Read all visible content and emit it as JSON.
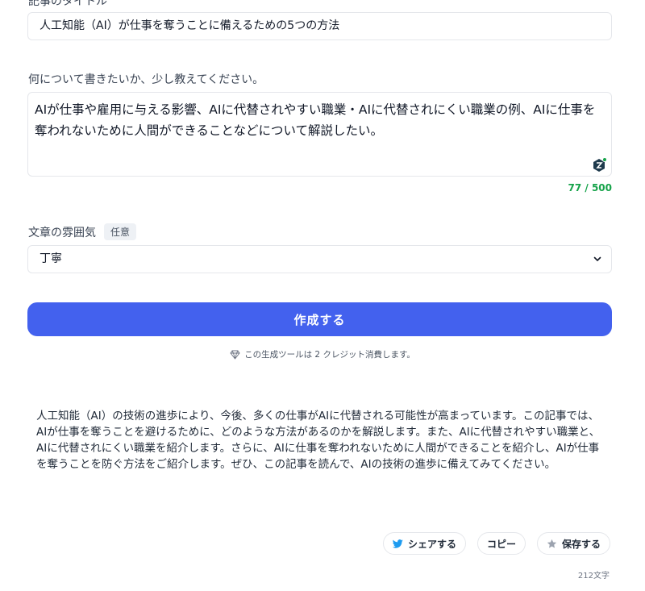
{
  "form": {
    "title_label_cut": "記事のタイトル",
    "title_value": "人工知能（AI）が仕事を奪うことに備えるための5つの方法",
    "description_label": "何について書きたいか、少し教えてください。",
    "description_value": "AIが仕事や雇用に与える影響、AIに代替されやすい職業・AIに代替されにくい職業の例、AIに仕事を奪われないために人間ができることなどについて解説したい。",
    "char_counter": "77 / 500",
    "tone_label": "文章の雰囲気",
    "tone_badge": "任意",
    "tone_selected": "丁寧",
    "submit_label": "作成する",
    "credit_notice": "この生成ツールは 2 クレジット消費します。"
  },
  "result": {
    "text": "人工知能（AI）の技術の進歩により、今後、多くの仕事がAIに代替される可能性が高まっています。この記事では、AIが仕事を奪うことを避けるために、どのような方法があるのかを解説します。また、AIに代替されやすい職業と、AIに代替されにくい職業を紹介します。さらに、AIに仕事を奪われないために人間ができることを紹介し、AIが仕事を奪うことを防ぐ方法をご紹介します。ぜひ、この記事を読んで、AIの技術の進歩に備えてみてください。",
    "share_label": "シェアする",
    "copy_label": "コピー",
    "save_label": "保存する",
    "char_count": "212文字"
  },
  "colors": {
    "primary": "#4361ee",
    "success": "#16a34a",
    "twitter": "#1d9bf0",
    "star": "#9ca3af"
  },
  "icons": {
    "assist": "ai-assist-icon",
    "chevron": "chevron-down-icon",
    "credit": "diamond-icon",
    "share": "twitter-icon",
    "save": "star-icon"
  }
}
